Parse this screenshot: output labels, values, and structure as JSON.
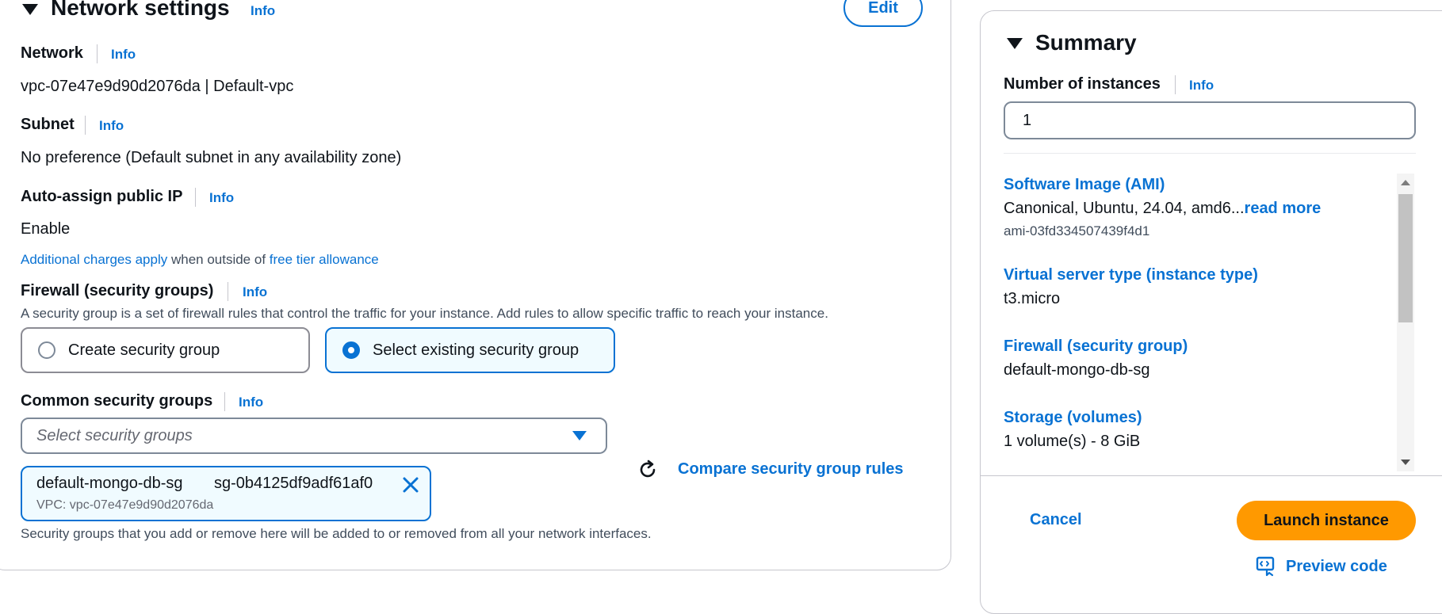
{
  "network_settings": {
    "title": "Network settings",
    "info": "Info",
    "edit_label": "Edit",
    "network": {
      "label": "Network",
      "info": "Info",
      "value": "vpc-07e47e9d90d2076da | Default-vpc"
    },
    "subnet": {
      "label": "Subnet",
      "info": "Info",
      "value": "No preference (Default subnet in any availability zone)"
    },
    "auto_assign": {
      "label": "Auto-assign public IP",
      "info": "Info",
      "value": "Enable"
    },
    "charges": {
      "link1": "Additional charges apply",
      "middle": " when outside of ",
      "link2": "free tier allowance"
    },
    "firewall": {
      "label": "Firewall (security groups)",
      "info": "Info",
      "description": "A security group is a set of firewall rules that control the traffic for your instance. Add rules to allow specific traffic to reach your instance.",
      "options": [
        {
          "label": "Create security group",
          "selected": false
        },
        {
          "label": "Select existing security group",
          "selected": true
        }
      ]
    },
    "common_sg": {
      "label": "Common security groups",
      "info": "Info",
      "placeholder": "Select security groups",
      "compare_link": "Compare security group rules",
      "token": {
        "name": "default-mongo-db-sg",
        "id": "sg-0b4125df9adf61af0",
        "vpc": "VPC: vpc-07e47e9d90d2076da"
      },
      "note": "Security groups that you add or remove here will be added to or removed from all your network interfaces."
    }
  },
  "summary": {
    "title": "Summary",
    "instances_label": "Number of instances",
    "instances_info": "Info",
    "instances_value": "1",
    "ami": {
      "title": "Software Image (AMI)",
      "value": "Canonical, Ubuntu, 24.04, amd6...",
      "read_more": "read more",
      "id": "ami-03fd334507439f4d1"
    },
    "instance_type": {
      "title": "Virtual server type (instance type)",
      "value": "t3.micro"
    },
    "firewall": {
      "title": "Firewall (security group)",
      "value": "default-mongo-db-sg"
    },
    "storage": {
      "title": "Storage (volumes)",
      "value": "1 volume(s) - 8 GiB"
    },
    "cancel_label": "Cancel",
    "launch_label": "Launch instance",
    "preview_label": "Preview code"
  },
  "colors": {
    "accent": "#0972d3",
    "launch": "#ff9900",
    "selected_bg": "#f0fbff"
  }
}
